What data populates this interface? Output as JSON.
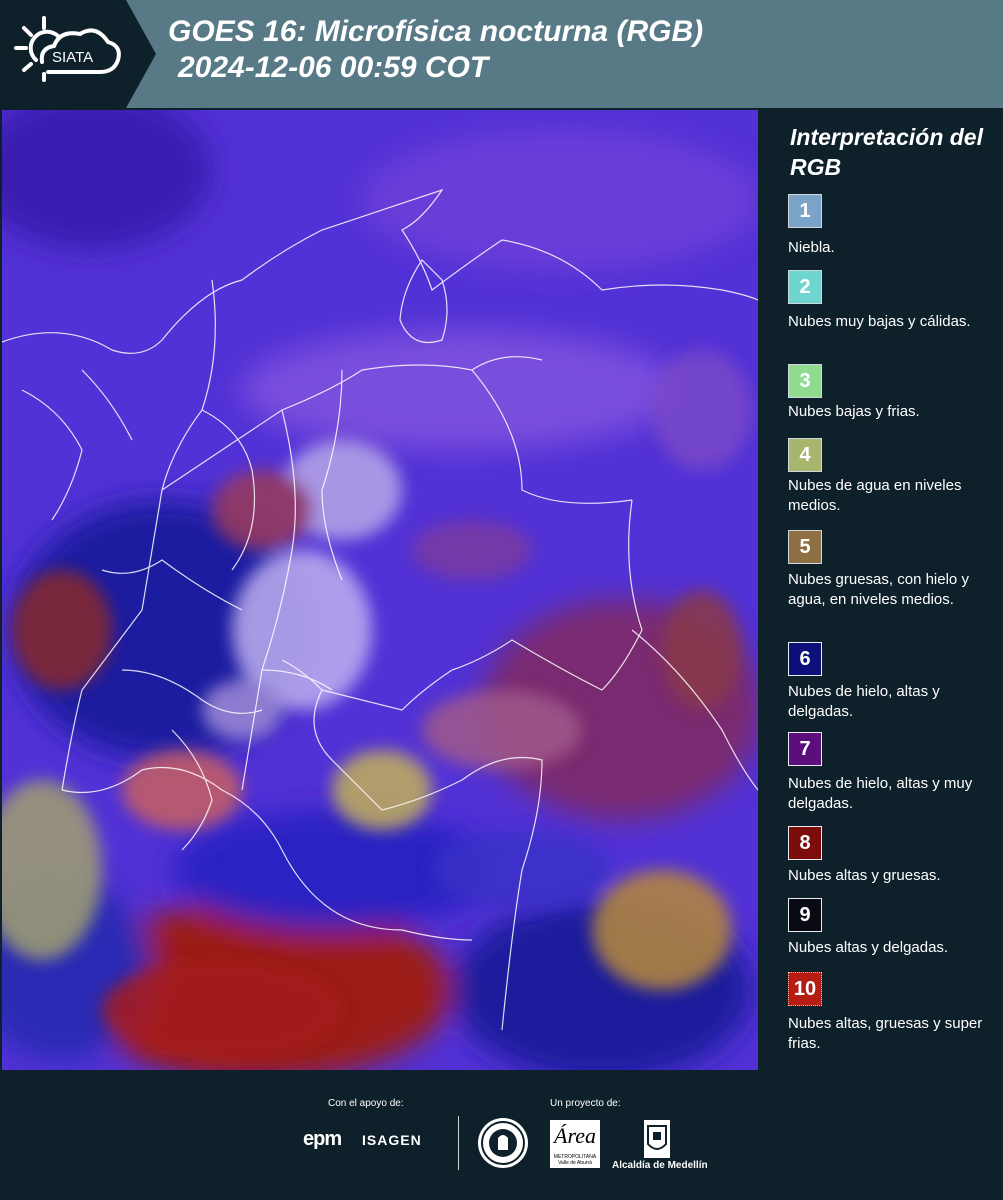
{
  "header": {
    "logo_text": "SIATA",
    "title_line1": "GOES 16: Microfísica nocturna (RGB)",
    "title_line2": "2024-12-06 00:59 COT"
  },
  "legend": {
    "title": "Interpretación del RGB",
    "items": [
      {
        "num": "1",
        "text": "Niebla.",
        "color": "#7ba3c9"
      },
      {
        "num": "2",
        "text": "Nubes muy bajas y cálidas.",
        "color": "#6fd6cf"
      },
      {
        "num": "3",
        "text": "Nubes bajas y frias.",
        "color": "#8fdb8f"
      },
      {
        "num": "4",
        "text": "Nubes de agua en niveles medios.",
        "color": "#a7b56d"
      },
      {
        "num": "5",
        "text": "Nubes gruesas, con hielo y agua, en niveles medios.",
        "color": "#8e7044"
      },
      {
        "num": "6",
        "text": "Nubes de hielo, altas y delgadas.",
        "color": "#0d0f7a"
      },
      {
        "num": "7",
        "text": "Nubes de hielo, altas y muy delgadas.",
        "color": "#5c0f7c"
      },
      {
        "num": "8",
        "text": "Nubes altas y gruesas.",
        "color": "#7d0c0c"
      },
      {
        "num": "9",
        "text": "Nubes altas y delgadas.",
        "color": "#0a0a14"
      },
      {
        "num": "10",
        "text": "Nubes altas, gruesas y super frias.",
        "color": "#b51c12"
      }
    ]
  },
  "footer": {
    "support_label": "Con el apoyo de:",
    "project_label": "Un proyecto de:",
    "epm": "epm",
    "isagen": "ISAGEN",
    "area_logo": "Área",
    "area_sub": "METROPOLITANA Valle de Aburrá",
    "alcaldia": "Alcaldía de Medellín"
  }
}
